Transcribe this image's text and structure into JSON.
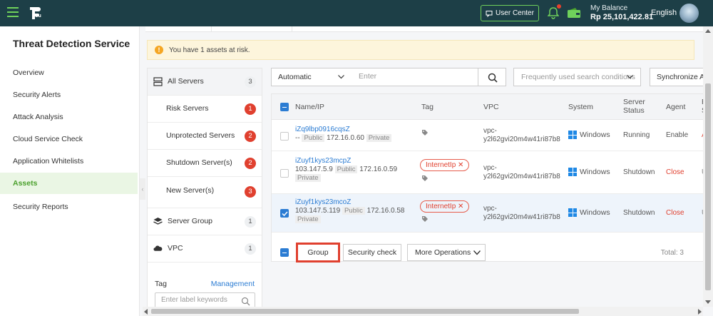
{
  "header": {
    "logo_text": "flou",
    "user_center": "User Center",
    "balance_label": "My Balance",
    "balance_value": "Rp 25,101,422.81",
    "language": "English"
  },
  "sidebar": {
    "title": "Threat Detection Service",
    "items": [
      {
        "label": "Overview",
        "active": false
      },
      {
        "label": "Security Alerts",
        "active": false
      },
      {
        "label": "Attack Analysis",
        "active": false
      },
      {
        "label": "Cloud Service Check",
        "active": false
      },
      {
        "label": "Application Whitelists",
        "active": false
      },
      {
        "label": "Assets",
        "active": true
      },
      {
        "label": "Security Reports",
        "active": false
      }
    ]
  },
  "alert": {
    "text": "You have 1 assets at risk."
  },
  "groups": {
    "all": {
      "label": "All Servers",
      "count": "3"
    },
    "risk": {
      "label": "Risk Servers",
      "count": "1"
    },
    "unprotected": {
      "label": "Unprotected Servers",
      "count": "2"
    },
    "shutdown": {
      "label": "Shutdown Server(s)",
      "count": "2"
    },
    "new": {
      "label": "New Server(s)",
      "count": "3"
    },
    "server_group": {
      "label": "Server Group",
      "count": "1"
    },
    "vpc": {
      "label": "VPC",
      "count": "1"
    },
    "tag_label": "Tag",
    "management": "Management",
    "tag_placeholder": "Enter label keywords"
  },
  "filter": {
    "mode": "Automatic",
    "search_placeholder": "Enter",
    "frequent": "Frequently used search conditions",
    "sync": "Synchronize A"
  },
  "table": {
    "headers": {
      "name": "Name/IP",
      "tag": "Tag",
      "vpc": "VPC",
      "system": "System",
      "status_1": "Server",
      "status_2": "Status",
      "agent": "Agent",
      "risk_1": "R",
      "risk_2": "S"
    },
    "rows": [
      {
        "name": "iZq9lbp0916cqsZ",
        "public_ip": "--",
        "public_label": "Public",
        "private_ip": "172.16.0.60",
        "private_label": "Private",
        "tag": "",
        "vpc_1": "vpc-",
        "vpc_2": "y2l62gvi20m4w41ri87b8",
        "system": "Windows",
        "status": "Running",
        "agent": "Enable",
        "risk": "A",
        "selected": false
      },
      {
        "name": "iZuyf1kys23mcpZ",
        "public_ip": "103.147.5.9",
        "public_label": "Public",
        "private_ip": "172.16.0.59",
        "private_label": "Private",
        "tag": "InternetIp",
        "vpc_1": "vpc-",
        "vpc_2": "y2l62gvi20m4w41ri87b8",
        "system": "Windows",
        "status": "Shutdown",
        "agent": "Close",
        "risk": "U",
        "selected": false
      },
      {
        "name": "iZuyf1kys23mcoZ",
        "public_ip": "103.147.5.119",
        "public_label": "Public",
        "private_ip": "172.16.0.58",
        "private_label": "Private",
        "tag": "InternetIp",
        "vpc_1": "vpc-",
        "vpc_2": "y2l62gvi20m4w41ri87b8",
        "system": "Windows",
        "status": "Shutdown",
        "agent": "Close",
        "risk": "U",
        "selected": true
      }
    ],
    "actions": {
      "group": "Group",
      "security_check": "Security check",
      "more": "More Operations"
    },
    "total": "Total: 3"
  },
  "colors": {
    "topbar": "#1d3f47",
    "accent_green": "#6fd15b",
    "link_blue": "#2b7cd3",
    "danger_red": "#e0402f"
  }
}
